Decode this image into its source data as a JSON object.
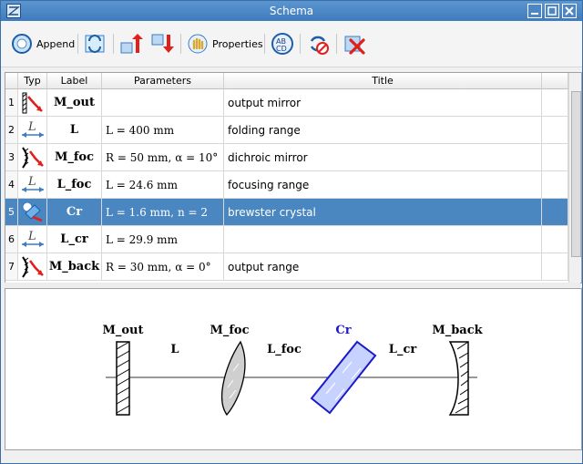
{
  "window": {
    "title": "Schema"
  },
  "toolbar": {
    "append_label": "Append",
    "properties_label": "Properties"
  },
  "grid": {
    "headers": {
      "typ": "Typ",
      "label": "Label",
      "parameters": "Parameters",
      "title": "Title"
    },
    "rows": [
      {
        "num": "1",
        "type": "mirror",
        "label": "M_out",
        "params": "",
        "title": "output mirror"
      },
      {
        "num": "2",
        "type": "range",
        "label": "L",
        "params": "L = 400 mm",
        "title": "folding range"
      },
      {
        "num": "3",
        "type": "curved-mirror",
        "label": "M_foc",
        "params": "R = 50 mm, α = 10°",
        "title": "dichroic mirror"
      },
      {
        "num": "4",
        "type": "range",
        "label": "L_foc",
        "params": "L = 24.6 mm",
        "title": "focusing range"
      },
      {
        "num": "5",
        "type": "crystal",
        "label": "Cr",
        "params": "L = 1.6 mm, n = 2",
        "title": "brewster crystal",
        "selected": true
      },
      {
        "num": "6",
        "type": "range",
        "label": "L_cr",
        "params": "L = 29.9 mm",
        "title": ""
      },
      {
        "num": "7",
        "type": "curved-mirror",
        "label": "M_back",
        "params": "R = 30 mm, α = 0°",
        "title": "output range"
      }
    ]
  },
  "schema": {
    "labels": {
      "m_out": "M_out",
      "l": "L",
      "m_foc": "M_foc",
      "l_foc": "L_foc",
      "cr": "Cr",
      "l_cr": "L_cr",
      "m_back": "M_back"
    },
    "highlight_color": "#1a1acc"
  },
  "colors": {
    "selection": "#4a86c0",
    "titlebar": "#4a88c8"
  }
}
